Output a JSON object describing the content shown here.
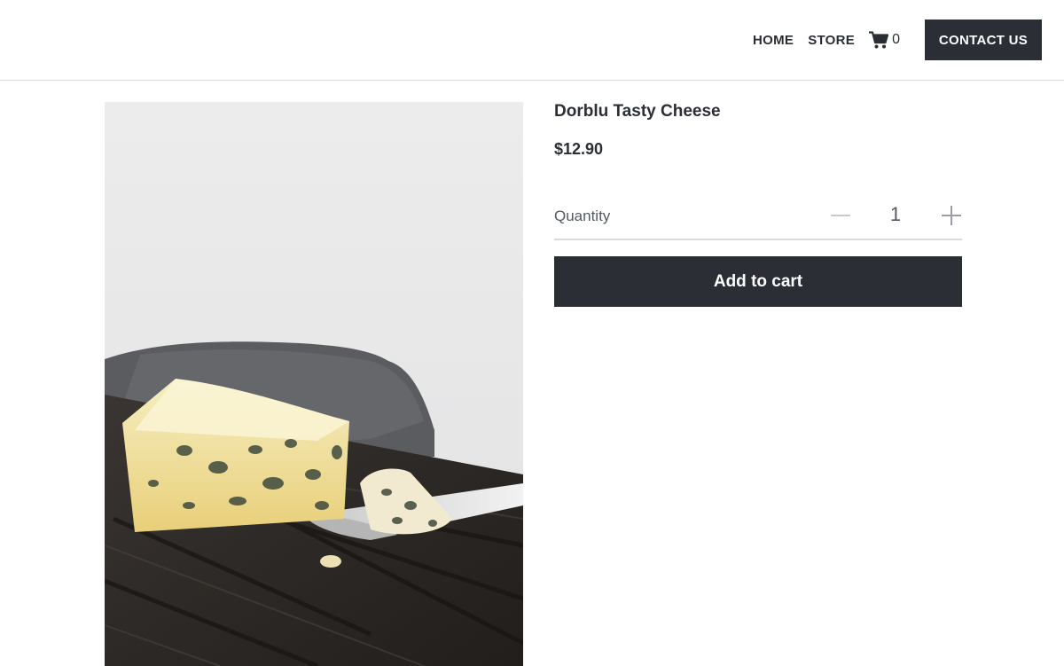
{
  "nav": {
    "home_label": "HOME",
    "store_label": "STORE",
    "cart_count": "0",
    "contact_label": "CONTACT US"
  },
  "product": {
    "title": "Dorblu Tasty Cheese",
    "price": "$12.90",
    "image_alt": "Dorblu blue cheese wedge on a dark wooden board with a cheese knife",
    "quantity_label": "Quantity",
    "quantity_value": "1",
    "add_to_cart_label": "Add to cart"
  },
  "icons": {
    "cart": "shopping-cart-icon",
    "minus": "minus-icon",
    "plus": "plus-icon"
  },
  "colors": {
    "primary_dark": "#2b2e35",
    "divider": "#dcdcdc"
  }
}
